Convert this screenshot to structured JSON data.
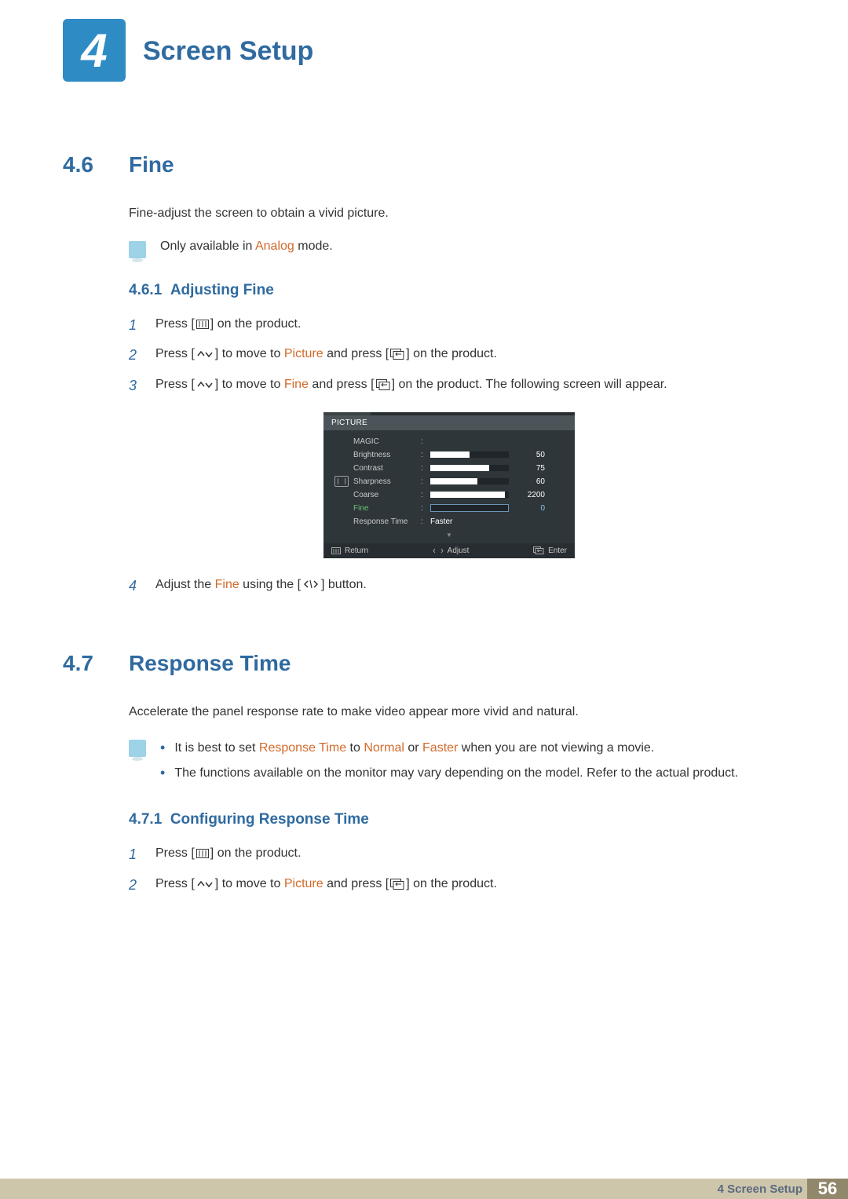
{
  "chapter_number": "4",
  "page_title": "Screen Setup",
  "section46": {
    "num": "4.6",
    "title": "Fine",
    "intro": "Fine-adjust the screen to obtain a vivid picture.",
    "note_pre": "Only available in ",
    "note_hl": "Analog",
    "note_post": " mode.",
    "sub_num": "4.6.1",
    "sub_title": "Adjusting Fine",
    "step1": "Press [",
    "step1b": "] on the product.",
    "step2a": "Press [",
    "step2b": "] to move to ",
    "step2_picture": "Picture",
    "step2c": " and press [",
    "step2d": "] on the product.",
    "step3a": "Press [",
    "step3b": "] to move to ",
    "step3_fine": "Fine",
    "step3c": " and press [",
    "step3d": "] on the product. The following screen will appear.",
    "step4a": "Adjust the ",
    "step4_fine": "Fine",
    "step4b": " using the [",
    "step4c": "] button."
  },
  "osd": {
    "header": "PICTURE",
    "rows": {
      "magic": "MAGIC",
      "brightness": "Brightness",
      "contrast": "Contrast",
      "sharpness": "Sharpness",
      "coarse": "Coarse",
      "fine": "Fine",
      "response": "Response Time"
    },
    "vals": {
      "brightness": "50",
      "contrast": "75",
      "sharpness": "60",
      "coarse": "2200",
      "fine": "0",
      "response": "Faster"
    },
    "foot": {
      "return": "Return",
      "adjust": "Adjust",
      "enter": "Enter"
    }
  },
  "section47": {
    "num": "4.7",
    "title": "Response Time",
    "intro": "Accelerate the panel response rate to make video appear more vivid and natural.",
    "note1a": "It is best to set ",
    "note1_rt": "Response Time",
    "note1b": " to ",
    "note1_normal": "Normal",
    "note1c": " or ",
    "note1_faster": "Faster",
    "note1d": " when you are not viewing a movie.",
    "note2": "The functions available on the monitor may vary depending on the model. Refer to the actual product.",
    "sub_num": "4.7.1",
    "sub_title": "Configuring Response Time",
    "step1": "Press [",
    "step1b": "] on the product.",
    "step2a": "Press [",
    "step2b": "] to move to ",
    "step2_picture": "Picture",
    "step2c": " and press [",
    "step2d": "] on the product."
  },
  "footer": {
    "text": "4 Screen Setup",
    "page": "56"
  },
  "chart_data": {
    "type": "table",
    "title": "PICTURE OSD menu values",
    "rows": [
      {
        "label": "MAGIC",
        "value": null
      },
      {
        "label": "Brightness",
        "value": 50
      },
      {
        "label": "Contrast",
        "value": 75
      },
      {
        "label": "Sharpness",
        "value": 60
      },
      {
        "label": "Coarse",
        "value": 2200
      },
      {
        "label": "Fine",
        "value": 0
      },
      {
        "label": "Response Time",
        "value": "Faster"
      }
    ]
  }
}
